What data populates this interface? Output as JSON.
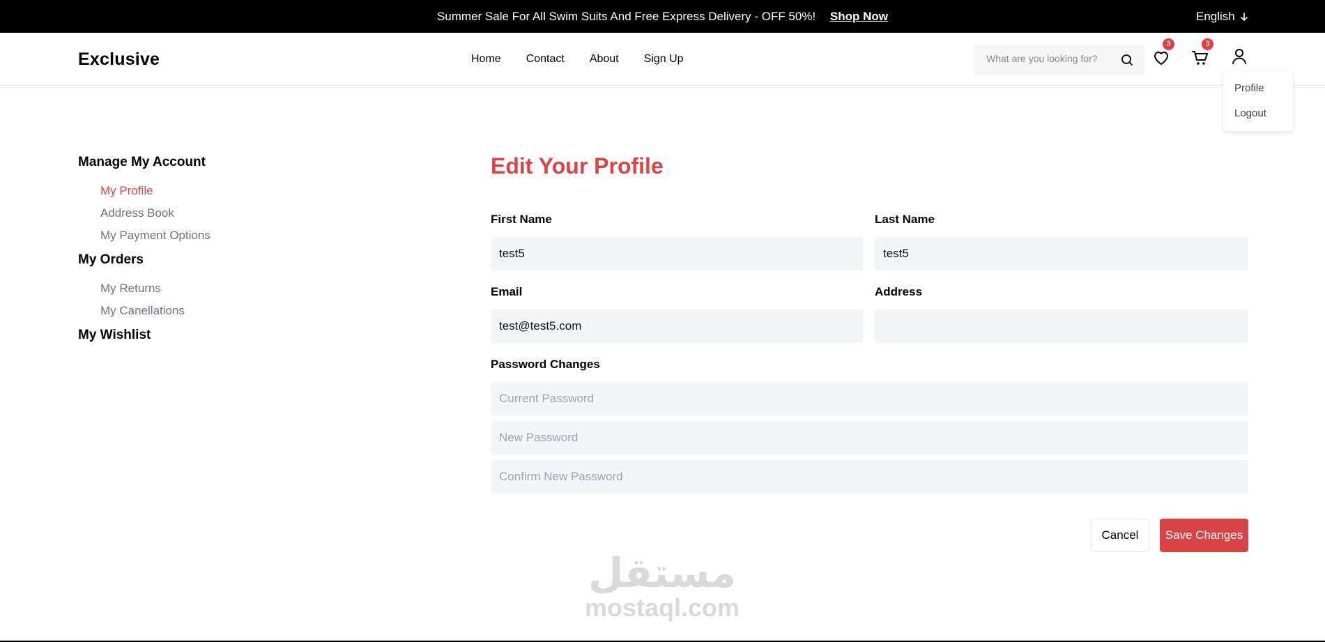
{
  "banner": {
    "promo_text": "Summer Sale For All Swim Suits And Free Express Delivery - OFF 50%!",
    "shop_link": "Shop Now",
    "language": "English"
  },
  "header": {
    "logo": "Exclusive",
    "nav": [
      "Home",
      "Contact",
      "About",
      "Sign Up"
    ],
    "search_placeholder": "What are you looking for?",
    "wishlist_count": "3",
    "cart_count": "3"
  },
  "user_menu": {
    "items": [
      "Profile",
      "Logout"
    ]
  },
  "sidebar": {
    "sections": [
      {
        "title": "Manage My Account",
        "items": [
          "My Profile",
          "Address Book",
          "My Payment Options"
        ]
      },
      {
        "title": "My Orders",
        "items": [
          "My Returns",
          "My Canellations"
        ]
      },
      {
        "title": "My Wishlist",
        "items": []
      }
    ],
    "active_item": "My Profile"
  },
  "form": {
    "title": "Edit Your Profile",
    "first_name_label": "First Name",
    "first_name_value": "test5",
    "last_name_label": "Last Name",
    "last_name_value": "test5",
    "email_label": "Email",
    "email_value": "test@test5.com",
    "address_label": "Address",
    "address_value": "",
    "password_label": "Password Changes",
    "current_password_placeholder": "Current Password",
    "new_password_placeholder": "New Password",
    "confirm_password_placeholder": "Confirm New Password",
    "cancel_label": "Cancel",
    "save_label": "Save Changes"
  },
  "watermark": {
    "arabic": "مستقل",
    "latin": "mostaql.com"
  },
  "colors": {
    "accent": "#db4444",
    "banner_bg": "#000000",
    "field_bg": "#f3f4f6"
  }
}
